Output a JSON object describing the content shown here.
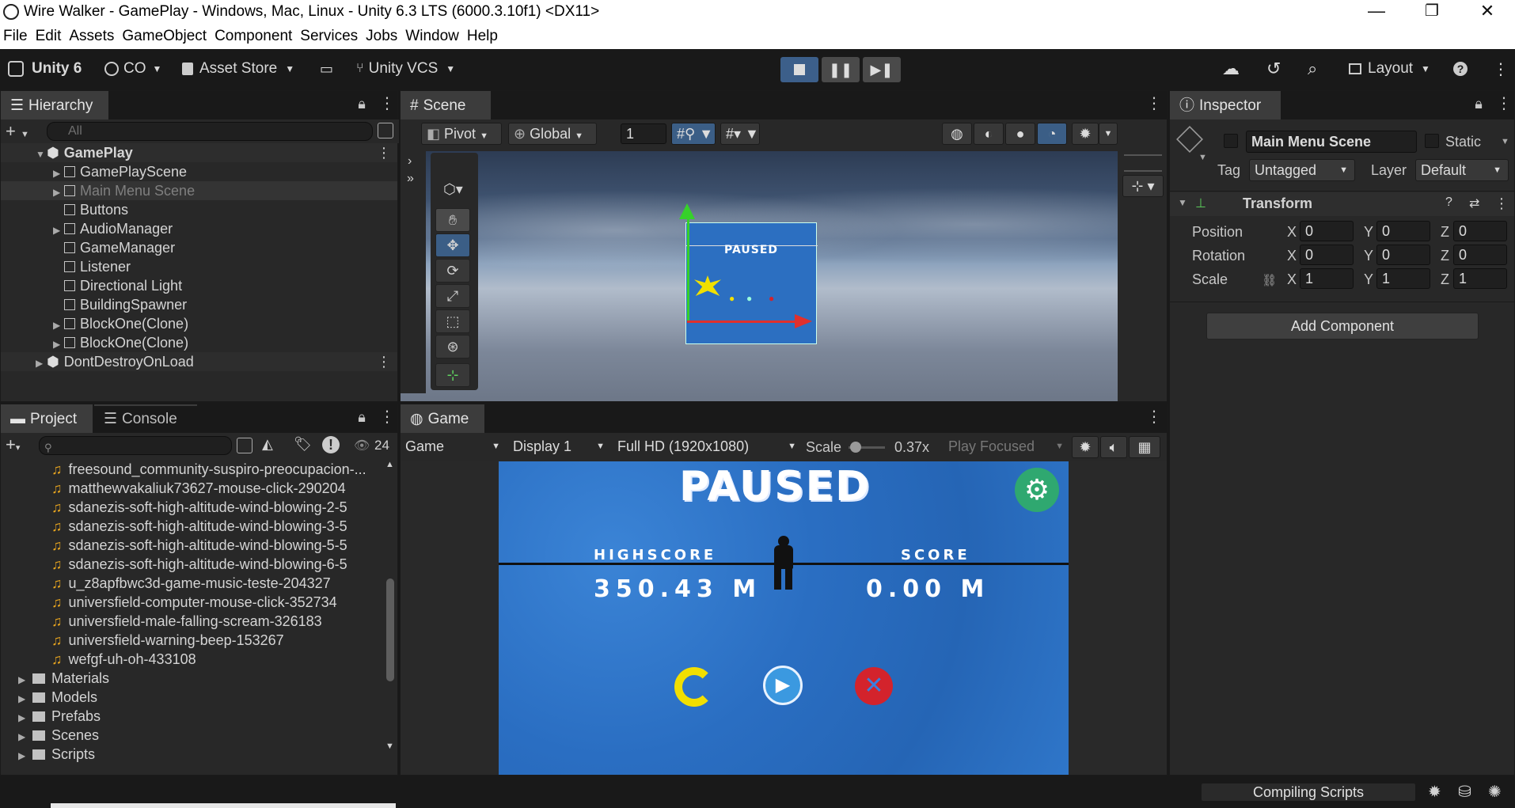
{
  "window": {
    "title": "Wire Walker - GamePlay - Windows, Mac, Linux - Unity 6.3 LTS (6000.3.10f1) <DX11>",
    "minimize": "—",
    "maximize": "❐",
    "close": "✕"
  },
  "menu": [
    "File",
    "Edit",
    "Assets",
    "GameObject",
    "Component",
    "Services",
    "Jobs",
    "Window",
    "Help"
  ],
  "toolbar": {
    "unity_label": "Unity 6",
    "account_label": "CO",
    "asset_store_label": "Asset Store",
    "vcs_label": "Unity VCS",
    "layout_label": "Layout"
  },
  "hierarchy": {
    "tab_label": "Hierarchy",
    "search_placeholder": "All",
    "scene_root": "GamePlay",
    "items": [
      {
        "label": "GamePlayScene",
        "expandable": true,
        "dim": false
      },
      {
        "label": "Main Menu Scene",
        "expandable": true,
        "dim": true
      },
      {
        "label": "Buttons",
        "expandable": false,
        "dim": false
      },
      {
        "label": "AudioManager",
        "expandable": true,
        "dim": false
      },
      {
        "label": "GameManager",
        "expandable": false,
        "dim": false
      },
      {
        "label": "Listener",
        "expandable": false,
        "dim": false
      },
      {
        "label": "Directional Light",
        "expandable": false,
        "dim": false
      },
      {
        "label": "BuildingSpawner",
        "expandable": false,
        "dim": false
      },
      {
        "label": "BlockOne(Clone)",
        "expandable": true,
        "dim": false
      },
      {
        "label": "BlockOne(Clone)",
        "expandable": true,
        "dim": false
      }
    ],
    "ddol_root": "DontDestroyOnLoad"
  },
  "scene": {
    "tab_label": "Scene",
    "pivot_label": "Pivot",
    "global_label": "Global",
    "grid_value": "1",
    "mini_title": "PAUSED"
  },
  "inspector": {
    "tab_label": "Inspector",
    "object_name": "Main Menu Scene",
    "static_label": "Static",
    "tag_label": "Tag",
    "tag_value": "Untagged",
    "layer_label": "Layer",
    "layer_value": "Default",
    "component_title": "Transform",
    "position_label": "Position",
    "rotation_label": "Rotation",
    "scale_label": "Scale",
    "position": [
      "0",
      "0",
      "0"
    ],
    "rotation": [
      "0",
      "0",
      "0"
    ],
    "scale": [
      "1",
      "1",
      "1"
    ],
    "axis": [
      "X",
      "Y",
      "Z"
    ],
    "add_component": "Add Component"
  },
  "project": {
    "tab_label": "Project",
    "console_label": "Console",
    "hidden_count": "24",
    "audio_files": [
      "freesound_community-suspiro-preocupacion-...",
      "matthewvakaliuk73627-mouse-click-290204",
      "sdanezis-soft-high-altitude-wind-blowing-2-5",
      "sdanezis-soft-high-altitude-wind-blowing-3-5",
      "sdanezis-soft-high-altitude-wind-blowing-5-5",
      "sdanezis-soft-high-altitude-wind-blowing-6-5",
      "u_z8apfbwc3d-game-music-teste-204327",
      "universfield-computer-mouse-click-352734",
      "universfield-male-falling-scream-326183",
      "universfield-warning-beep-153267",
      "wefgf-uh-oh-433108"
    ],
    "folders": [
      "Materials",
      "Models",
      "Prefabs",
      "Scenes",
      "Scripts"
    ]
  },
  "game": {
    "tab_label": "Game",
    "view_mode": "Game",
    "display": "Display 1",
    "resolution": "Full HD (1920x1080)",
    "scale_label": "Scale",
    "scale_value": "0.37x",
    "scale_fraction": 0.05,
    "play_mode": "Play Focused",
    "paused_title": "PAUSED",
    "highscore_label": "HIGHSCORE",
    "highscore_value": "350.43 M",
    "score_label": "SCORE",
    "score_value": "0.00 M"
  },
  "status": {
    "text": "Compiling Scripts"
  },
  "colors": {
    "editor_bg": "#191919",
    "panel": "#282828",
    "game_blue": "#2f76c9",
    "settings_green": "#2fa870",
    "restart_yellow": "#f2df00",
    "play_blue": "#3b99e0",
    "quit_red": "#d3232c"
  }
}
